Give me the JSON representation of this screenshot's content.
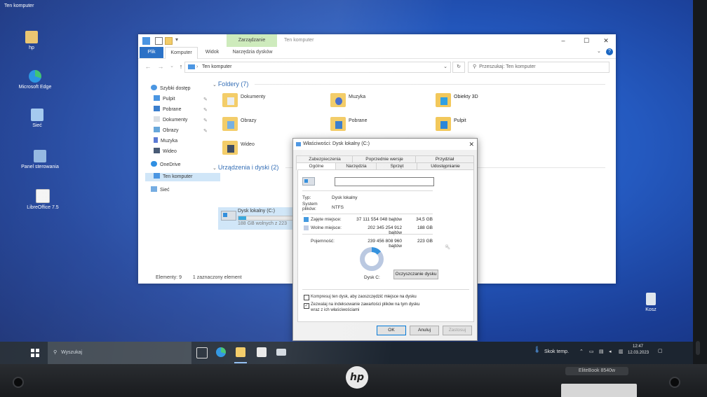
{
  "desktop": {
    "top_label": "Ten komputer",
    "icons": [
      {
        "label": "hp"
      },
      {
        "label": "Microsoft Edge"
      },
      {
        "label": "Sieć"
      },
      {
        "label": "Panel sterowania"
      },
      {
        "label": "LibreOffice 7.5"
      },
      {
        "label": "Kosz"
      }
    ]
  },
  "explorer": {
    "context_tab": "Zarządzanie",
    "window_title": "Ten komputer",
    "ribbon_tabs": [
      "Plik",
      "Komputer",
      "Widok",
      "Narzędzia dysków"
    ],
    "address": "Ten komputer",
    "search_placeholder": "Przeszukaj: Ten komputer",
    "sidebar": [
      {
        "label": "Szybki dostęp",
        "icon": "star-icon"
      },
      {
        "label": "Pulpit",
        "icon": "desktop-folder-icon"
      },
      {
        "label": "Pobrane",
        "icon": "download-icon"
      },
      {
        "label": "Dokumenty",
        "icon": "documents-icon"
      },
      {
        "label": "Obrazy",
        "icon": "pictures-icon"
      },
      {
        "label": "Muzyka",
        "icon": "music-icon"
      },
      {
        "label": "Wideo",
        "icon": "video-icon"
      },
      {
        "label": "OneDrive",
        "icon": "cloud-icon"
      },
      {
        "label": "Ten komputer",
        "icon": "computer-icon"
      },
      {
        "label": "Sieć",
        "icon": "network-icon"
      }
    ],
    "folders_header": "Foldery (7)",
    "folders": [
      {
        "label": "Dokumenty"
      },
      {
        "label": "Muzyka"
      },
      {
        "label": "Obiekty 3D"
      },
      {
        "label": "Obrazy"
      },
      {
        "label": "Pobrane"
      },
      {
        "label": "Pulpit"
      },
      {
        "label": "Wideo"
      }
    ],
    "devices_header": "Urządzenia i dyski (2)",
    "drive": {
      "label": "Dysk lokalny (C:)",
      "free": "188 GB wolnych z 223",
      "used_fraction": 0.14
    },
    "status_items": "Elementy: 9",
    "status_selected": "1 zaznaczony element"
  },
  "dialog": {
    "title": "Właściwości: Dysk lokalny (C:)",
    "tabs_row1": [
      "Zabezpieczenia",
      "Poprzednie wersje",
      "Przydział"
    ],
    "tabs_row2": [
      "Ogólne",
      "Narzędzia",
      "Sprzęt",
      "Udostępnianie"
    ],
    "name_value": "",
    "type_label": "Typ:",
    "type_value": "Dysk lokalny",
    "fs_label": "System plików:",
    "fs_value": "NTFS",
    "used_label": "Zajęte miejsce:",
    "used_bytes": "37 111 554 048 bajtów",
    "used_gb": "34,5 GB",
    "free_label": "Wolne miejsce:",
    "free_bytes": "202 345 254 912 bajtów",
    "free_gb": "188 GB",
    "cap_label": "Pojemność:",
    "cap_bytes": "239 456 808 960 bajtów",
    "cap_gb": "223 GB",
    "disk_label": "Dysk C:",
    "cleanup_button": "Oczyszczanie dysku",
    "compress_label": "Kompresuj ten dysk, aby zaoszczędzić miejsce na dysku",
    "index_label_1": "Zezwalaj na indeksowanie zawartości plików na tym dysku",
    "index_label_2": "wraz z ich właściwościami",
    "ok": "OK",
    "cancel": "Anuluj",
    "apply": "Zastosuj",
    "used_color": "#2f8fdd",
    "free_color": "#b8c7e0"
  },
  "taskbar": {
    "search_placeholder": "Wyszukaj",
    "weather": "Skok temp.",
    "time": "12:47",
    "date": "12.03.2023"
  },
  "laptop": {
    "brand": "hp",
    "model": "EliteBook 8540w"
  }
}
